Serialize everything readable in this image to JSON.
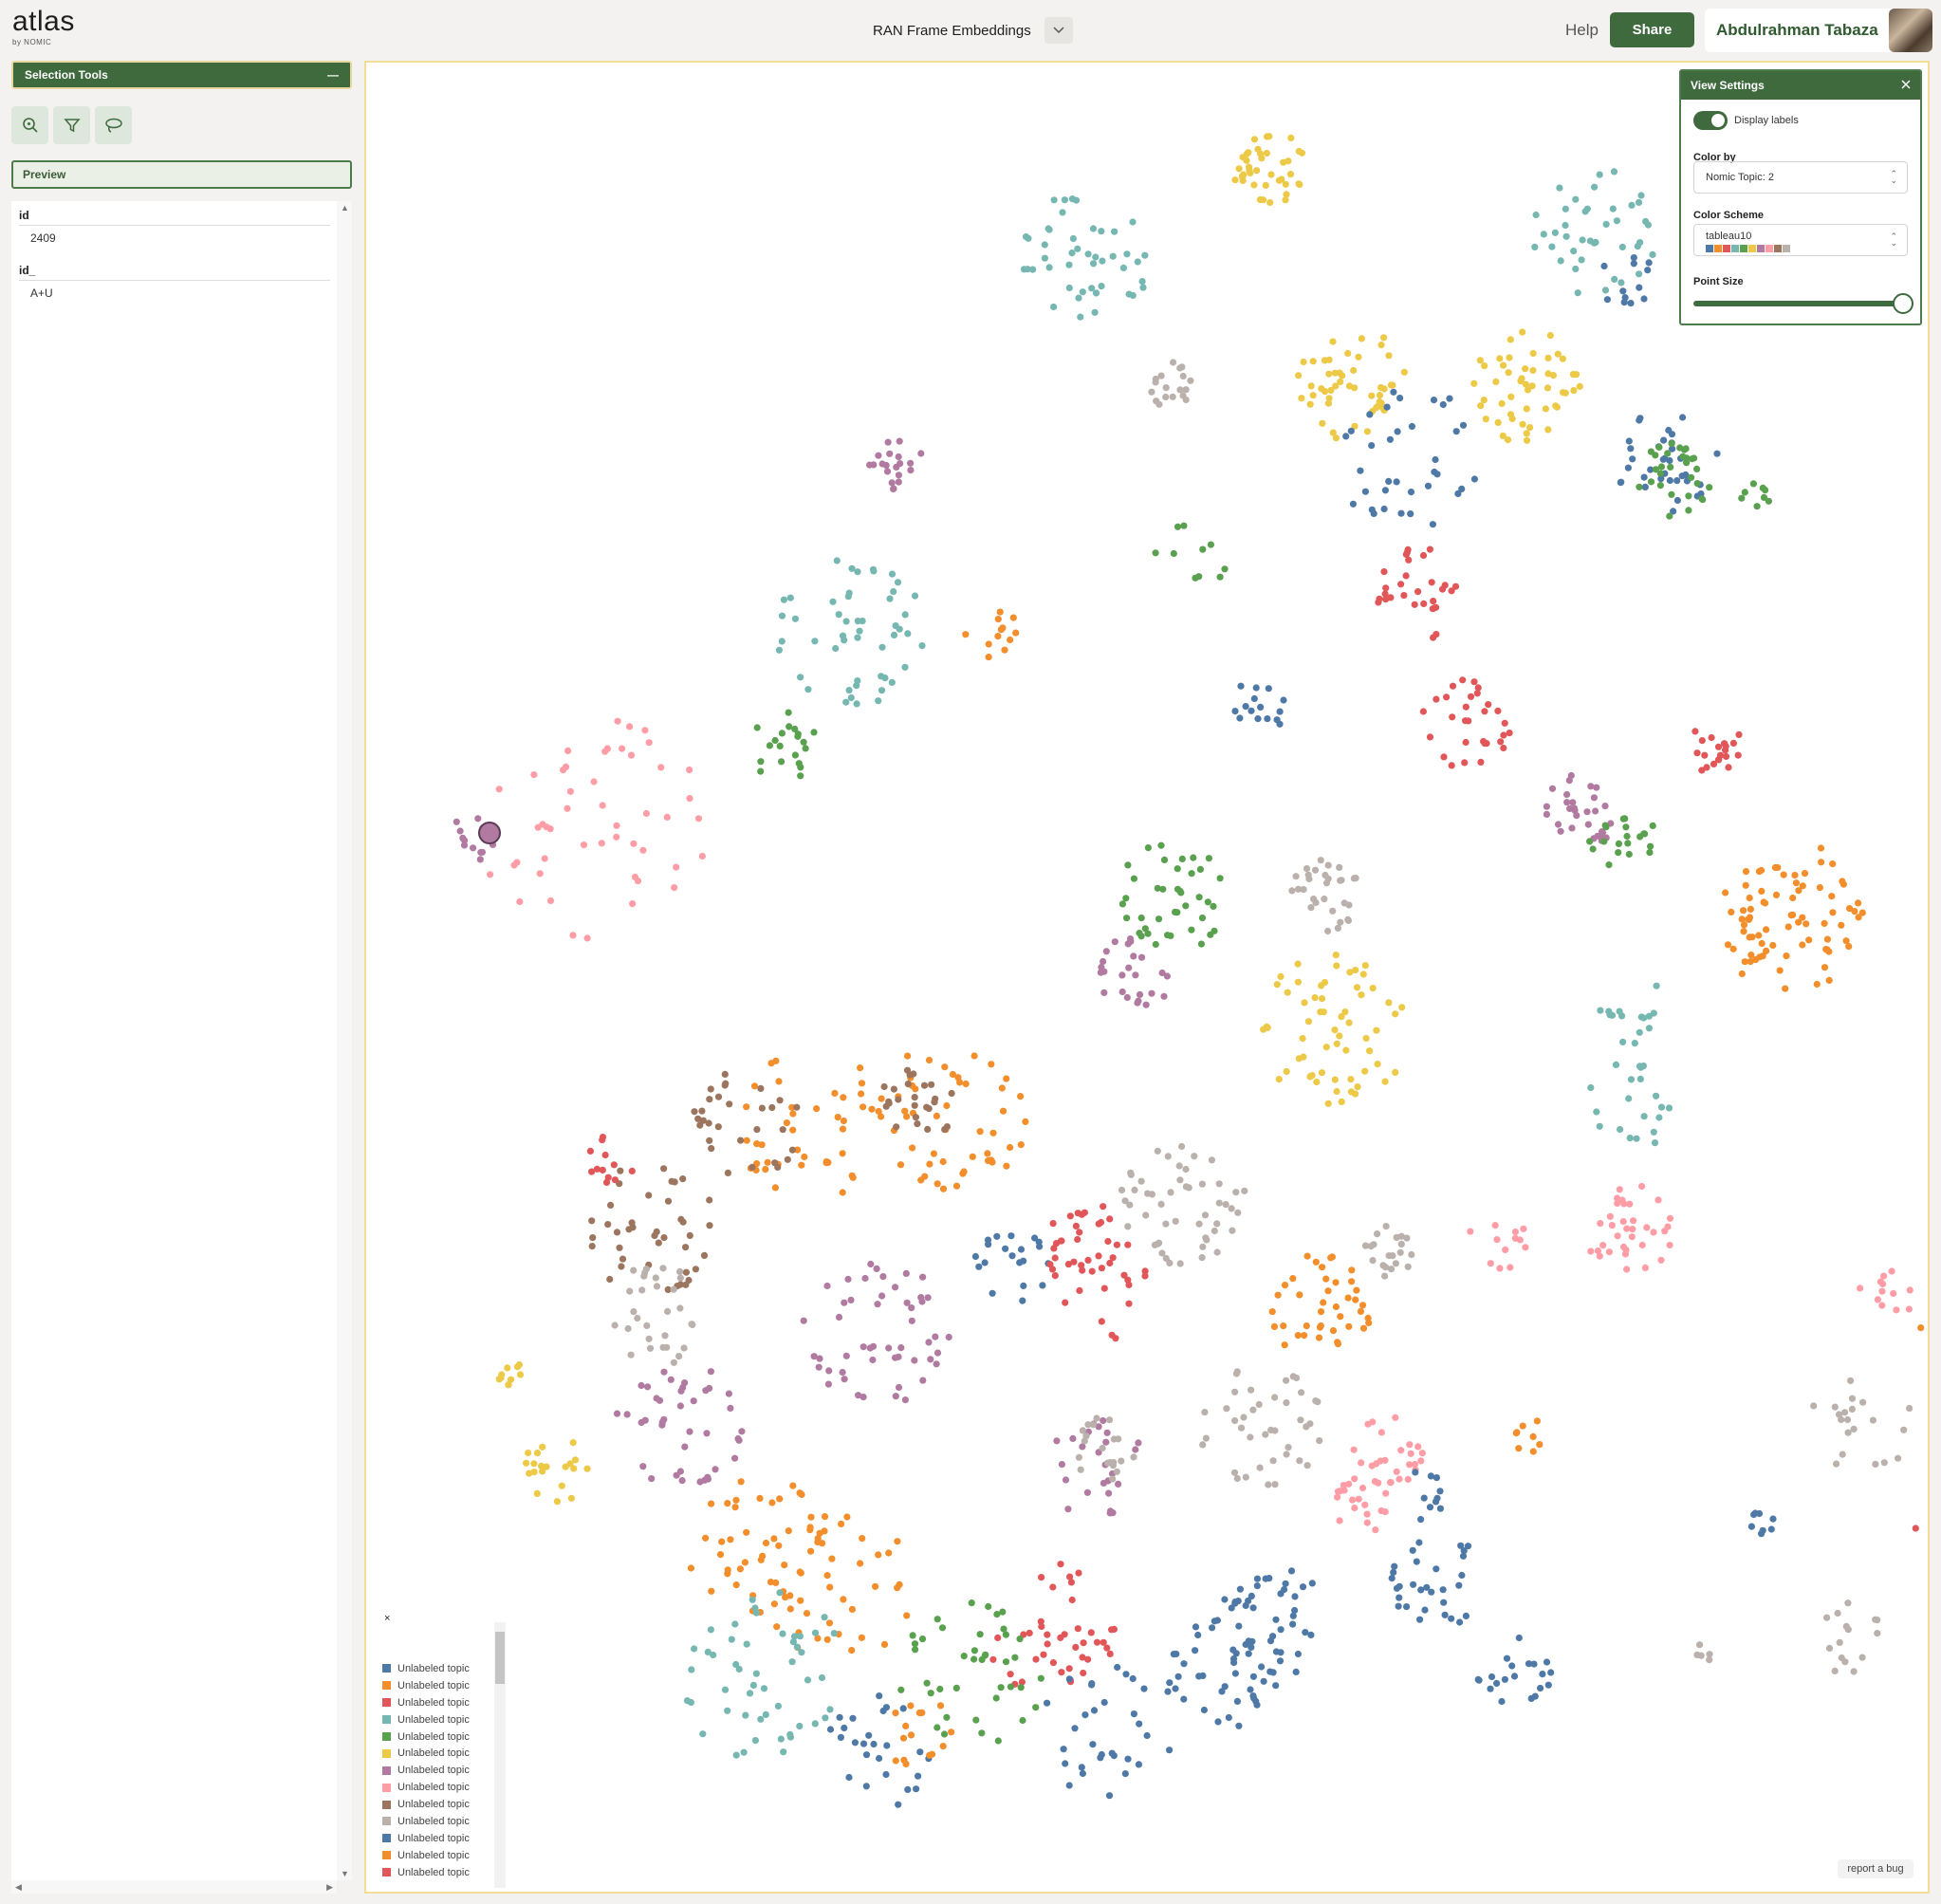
{
  "app": {
    "logo": "atlas",
    "logo_sub": "by NOMIC",
    "title": "RAN Frame Embeddings"
  },
  "header": {
    "help": "Help",
    "share": "Share",
    "user": "Abdulrahman Tabaza"
  },
  "left": {
    "selection_tools": "Selection Tools",
    "collapse": "—",
    "preview": "Preview",
    "fields": [
      {
        "name": "id",
        "value": "2409"
      },
      {
        "name": "id_",
        "value": "A+U"
      }
    ]
  },
  "view_settings": {
    "title": "View Settings",
    "display_labels": "Display labels",
    "display_labels_on": true,
    "color_by_label": "Color by",
    "color_by_value": "Nomic Topic: 2",
    "color_scheme_label": "Color Scheme",
    "color_scheme_value": "tableau10",
    "point_size_label": "Point Size",
    "point_size_level": 1.0
  },
  "colors": {
    "accent": "#3f6a3e",
    "palette": [
      "#4e79a7",
      "#f28e2b",
      "#e15759",
      "#76b7b2",
      "#59a14f",
      "#edc948",
      "#b07aa1",
      "#ff9da7",
      "#9c755f",
      "#bab0ac"
    ]
  },
  "legend": {
    "close": "×",
    "items": [
      {
        "label": "Unlabeled topic",
        "color": "#4e79a7"
      },
      {
        "label": "Unlabeled topic",
        "color": "#f28e2b"
      },
      {
        "label": "Unlabeled topic",
        "color": "#e15759"
      },
      {
        "label": "Unlabeled topic",
        "color": "#76b7b2"
      },
      {
        "label": "Unlabeled topic",
        "color": "#59a14f"
      },
      {
        "label": "Unlabeled topic",
        "color": "#edc948"
      },
      {
        "label": "Unlabeled topic",
        "color": "#b07aa1"
      },
      {
        "label": "Unlabeled topic",
        "color": "#ff9da7"
      },
      {
        "label": "Unlabeled topic",
        "color": "#9c755f"
      },
      {
        "label": "Unlabeled topic",
        "color": "#bab0ac"
      },
      {
        "label": "Unlabeled topic",
        "color": "#4e79a7"
      },
      {
        "label": "Unlabeled topic",
        "color": "#f28e2b"
      },
      {
        "label": "Unlabeled topic",
        "color": "#e15759"
      }
    ]
  },
  "report_bug": "report a bug"
}
